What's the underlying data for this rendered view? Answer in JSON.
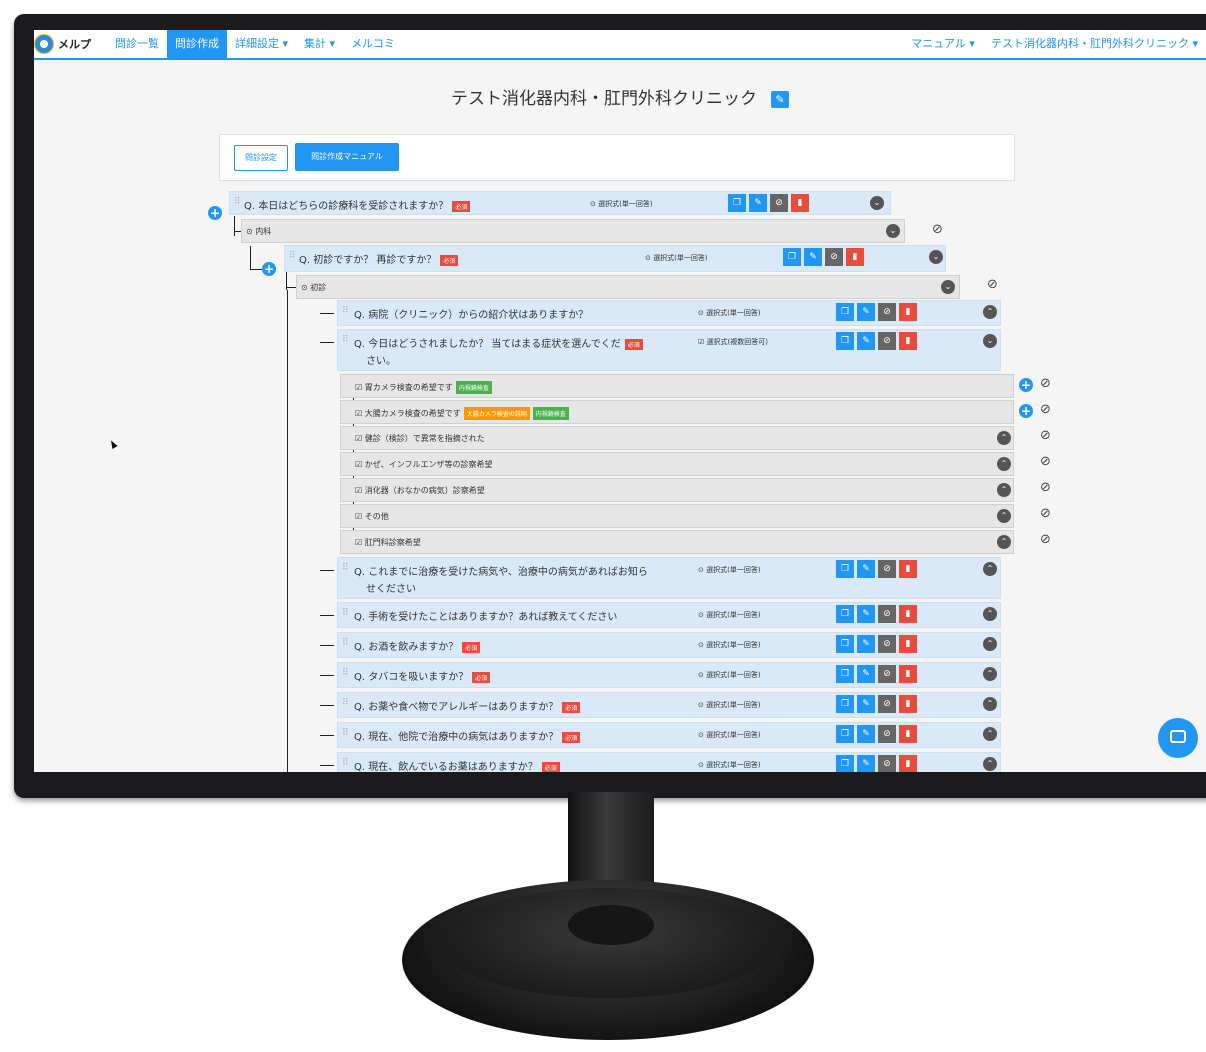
{
  "nav": {
    "logo": "メルプ",
    "items": [
      "問診一覧",
      "問診作成",
      "詳細設定 ▾",
      "集計 ▾",
      "メルコミ"
    ],
    "right": [
      "マニュアル ▾",
      "テスト消化器内科・肛門外科クリニック ▾"
    ]
  },
  "page_title": "テスト消化器内科・肛門外科クリニック",
  "panel": {
    "btn_settings": "問診設定",
    "btn_manual": "問診作成マニュアル"
  },
  "required_label": "必須",
  "type_single": "⊙ 選択式(単一回答)",
  "type_multi": "☑ 選択式(複数回答可)",
  "q1": {
    "text": "Q. 本日はどちらの診療科を受診されますか？"
  },
  "opt_naika": "⊙ 内科",
  "q2": {
    "text": "Q. 初診ですか？ 再診ですか？"
  },
  "opt_shoshin": "⊙ 初診",
  "q3": {
    "text": "Q. 病院（クリニック）からの紹介状はありますか？"
  },
  "q4": {
    "text1": "Q. 今日はどうされましたか？ 当てはまる症状を選んでくだ",
    "text2": "さい。"
  },
  "options": [
    {
      "label": "☑ 胃カメラ検査の希望です"
    },
    {
      "label": "☑ 大腸カメラ検査の希望です"
    },
    {
      "label": "☑ 健診（検診）で異常を指摘された"
    },
    {
      "label": "☑ かぜ、インフルエンザ等の診察希望"
    },
    {
      "label": "☑ 消化器（おなかの病気）診察希望"
    },
    {
      "label": "☑ その他"
    },
    {
      "label": "☑ 肛門科診察希望"
    }
  ],
  "tags": {
    "endoscopy": "内視鏡検査",
    "colon_desc": "大腸カメラ検査の説明"
  },
  "questions": [
    {
      "text1": "Q. これまでに治療を受けた病気や、治療中の病気があればお知ら",
      "text2": "せください"
    },
    {
      "text1": "Q. 手術を受けたことはありますか？あれば教えてください"
    },
    {
      "text1": "Q. お酒を飲みますか？"
    },
    {
      "text1": "Q. タバコを吸いますか？"
    },
    {
      "text1": "Q. お薬や食べ物でアレルギーはありますか？"
    },
    {
      "text1": "Q. 現在、他院で治療中の病気はありますか？"
    },
    {
      "text1": "Q. 現在、飲んでいるお薬はありますか？"
    }
  ],
  "colors": {
    "accent": "#2196f3",
    "danger": "#e74c3c",
    "success": "#4caf50",
    "warning": "#ff9800",
    "row_bg": "#d9e9f7"
  }
}
